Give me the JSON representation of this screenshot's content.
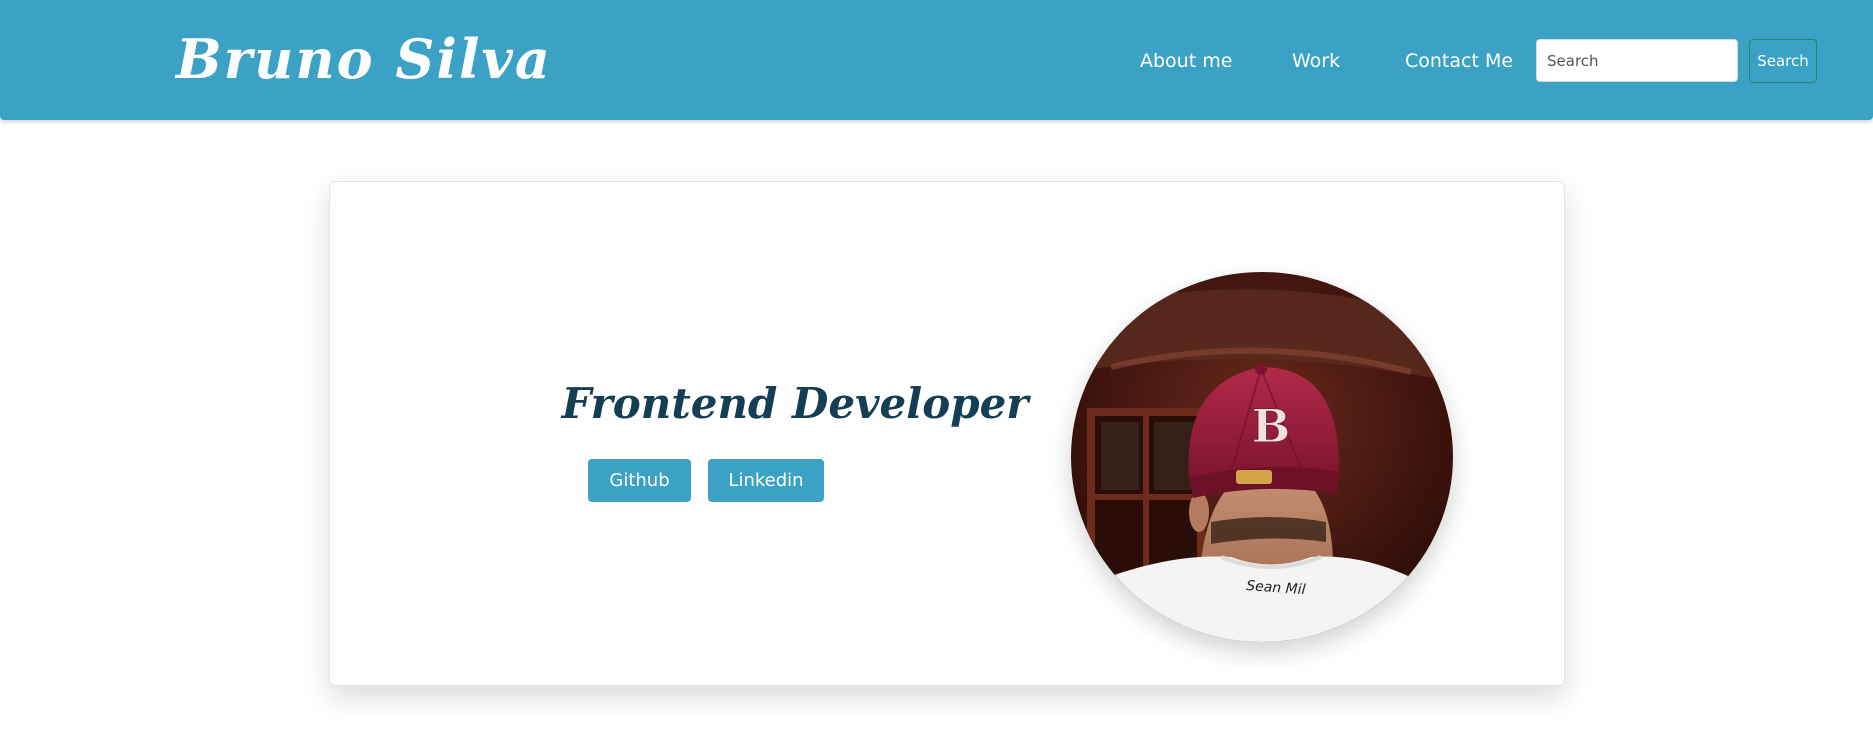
{
  "header": {
    "brand": "Bruno Silva",
    "nav": [
      {
        "label": "About me"
      },
      {
        "label": "Work"
      },
      {
        "label": "Contact Me"
      }
    ],
    "search": {
      "placeholder": "Search",
      "value": "",
      "button_label": "Search"
    }
  },
  "hero": {
    "title": "Frontend Developer",
    "buttons": [
      {
        "label": "Github"
      },
      {
        "label": "Linkedin"
      }
    ],
    "profile_image": {
      "icon": "profile-photo",
      "cap_letter": "B",
      "shirt_text": "Sean Mil"
    }
  },
  "colors": {
    "primary": "#3ba2c6",
    "headline": "#143e54",
    "cap": "#9e1f3c"
  }
}
